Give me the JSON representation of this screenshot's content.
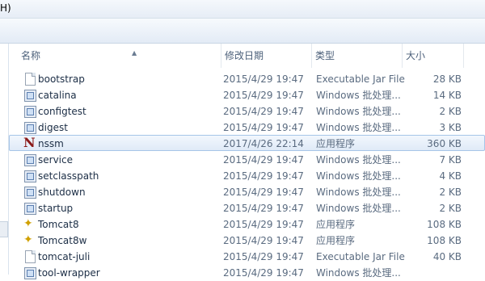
{
  "menubar": {
    "visible_fragment": "H)"
  },
  "columns": {
    "name": "名称",
    "date": "修改日期",
    "type": "类型",
    "size": "大小"
  },
  "files": [
    {
      "name": "bootstrap",
      "date": "2015/4/29 19:47",
      "type": "Executable Jar File",
      "size": "28 KB",
      "icon": "document-icon"
    },
    {
      "name": "catalina",
      "date": "2015/4/29 19:47",
      "type": "Windows 批处理...",
      "size": "14 KB",
      "icon": "batch-file-icon"
    },
    {
      "name": "configtest",
      "date": "2015/4/29 19:47",
      "type": "Windows 批处理...",
      "size": "2 KB",
      "icon": "batch-file-icon"
    },
    {
      "name": "digest",
      "date": "2015/4/29 19:47",
      "type": "Windows 批处理...",
      "size": "3 KB",
      "icon": "batch-file-icon"
    },
    {
      "name": "nssm",
      "date": "2017/4/26 22:14",
      "type": "应用程序",
      "size": "360 KB",
      "icon": "nssm-app-icon",
      "selected": true
    },
    {
      "name": "service",
      "date": "2015/4/29 19:47",
      "type": "Windows 批处理...",
      "size": "7 KB",
      "icon": "batch-file-icon"
    },
    {
      "name": "setclasspath",
      "date": "2015/4/29 19:47",
      "type": "Windows 批处理...",
      "size": "4 KB",
      "icon": "batch-file-icon"
    },
    {
      "name": "shutdown",
      "date": "2015/4/29 19:47",
      "type": "Windows 批处理...",
      "size": "2 KB",
      "icon": "batch-file-icon"
    },
    {
      "name": "startup",
      "date": "2015/4/29 19:47",
      "type": "Windows 批处理...",
      "size": "2 KB",
      "icon": "batch-file-icon"
    },
    {
      "name": "Tomcat8",
      "date": "2015/4/29 19:47",
      "type": "应用程序",
      "size": "108 KB",
      "icon": "tomcat-app-icon"
    },
    {
      "name": "Tomcat8w",
      "date": "2015/4/29 19:47",
      "type": "应用程序",
      "size": "108 KB",
      "icon": "tomcat-app-icon"
    },
    {
      "name": "tomcat-juli",
      "date": "2015/4/29 19:47",
      "type": "Executable Jar File",
      "size": "40 KB",
      "icon": "document-icon"
    },
    {
      "name": "tool-wrapper",
      "date": "2015/4/29 19:47",
      "type": "Windows 批处理...",
      "size": "",
      "icon": "batch-file-icon"
    }
  ],
  "colors": {
    "selection_border": "#a6c5e8",
    "selection_fill": "#dfeaf7",
    "text": "#1e395b"
  }
}
